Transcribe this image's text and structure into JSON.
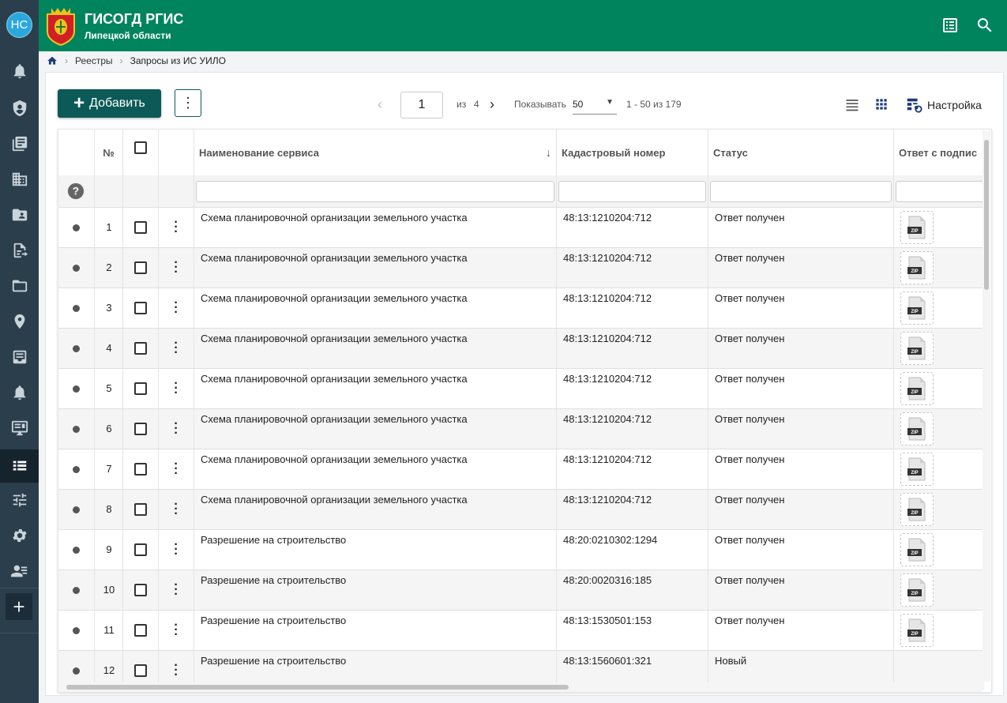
{
  "user": {
    "initials": "НС"
  },
  "app": {
    "title": "ГИСОГД РГИС",
    "subtitle": "Липецкой области"
  },
  "breadcrumb": {
    "items": [
      "Реестры",
      "Запросы из ИС УИЛО"
    ]
  },
  "toolbar": {
    "add_label": "Добавить",
    "page_value": "1",
    "of_label": "из",
    "total_pages": "4",
    "show_label": "Показывать",
    "per_page": "50",
    "range": "1 - 50 из 179",
    "settings_label": "Настройка"
  },
  "table": {
    "columns": {
      "num": "№",
      "service": "Наименование сервиса",
      "cadastral": "Кадастровый номер",
      "status": "Статус",
      "signed": "Ответ с подпис"
    },
    "rows": [
      {
        "n": "1",
        "service": "Схема планировочной организации земельного участка",
        "cadastral": "48:13:1210204:712",
        "status": "Ответ получен",
        "zip": true
      },
      {
        "n": "2",
        "service": "Схема планировочной организации земельного участка",
        "cadastral": "48:13:1210204:712",
        "status": "Ответ получен",
        "zip": true
      },
      {
        "n": "3",
        "service": "Схема планировочной организации земельного участка",
        "cadastral": "48:13:1210204:712",
        "status": "Ответ получен",
        "zip": true
      },
      {
        "n": "4",
        "service": "Схема планировочной организации земельного участка",
        "cadastral": "48:13:1210204:712",
        "status": "Ответ получен",
        "zip": true
      },
      {
        "n": "5",
        "service": "Схема планировочной организации земельного участка",
        "cadastral": "48:13:1210204:712",
        "status": "Ответ получен",
        "zip": true
      },
      {
        "n": "6",
        "service": "Схема планировочной организации земельного участка",
        "cadastral": "48:13:1210204:712",
        "status": "Ответ получен",
        "zip": true
      },
      {
        "n": "7",
        "service": "Схема планировочной организации земельного участка",
        "cadastral": "48:13:1210204:712",
        "status": "Ответ получен",
        "zip": true
      },
      {
        "n": "8",
        "service": "Схема планировочной организации земельного участка",
        "cadastral": "48:13:1210204:712",
        "status": "Ответ получен",
        "zip": true
      },
      {
        "n": "9",
        "service": "Разрешение на строительство",
        "cadastral": "48:20:0210302:1294",
        "status": "Ответ получен",
        "zip": true
      },
      {
        "n": "10",
        "service": "Разрешение на строительство",
        "cadastral": "48:20:0020316:185",
        "status": "Ответ получен",
        "zip": true
      },
      {
        "n": "11",
        "service": "Разрешение на строительство",
        "cadastral": "48:13:1530501:153",
        "status": "Ответ получен",
        "zip": true
      },
      {
        "n": "12",
        "service": "Разрешение на строительство",
        "cadastral": "48:13:1560601:321",
        "status": "Новый",
        "zip": false
      }
    ]
  },
  "sidebar_icons": [
    "bell-icon",
    "shield-icon",
    "book-icon",
    "buildings-icon",
    "contact-folder-icon",
    "document-export-icon",
    "folder-open-icon",
    "map-pin-icon",
    "inbox-icon",
    "notification-bell-icon",
    "monitor-icon",
    "registry-list-icon",
    "sliders-icon",
    "gear-icon",
    "users-list-icon"
  ],
  "colors": {
    "header": "#00845e",
    "sidebar": "#2b3e4c",
    "primary_button": "#0c5a57"
  }
}
